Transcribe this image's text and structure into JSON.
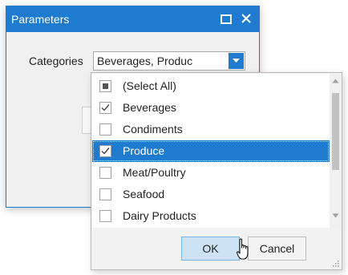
{
  "window": {
    "title": "Parameters",
    "maximize_icon": "maximize-icon",
    "close_icon": "close-icon"
  },
  "form": {
    "categories_label": "Categories",
    "categories_value": "Beverages, Produc"
  },
  "dropdown": {
    "items": [
      {
        "label": "(Select All)",
        "state": "indeterminate"
      },
      {
        "label": "Beverages",
        "state": "checked"
      },
      {
        "label": "Condiments",
        "state": "unchecked"
      },
      {
        "label": "Produce",
        "state": "checked",
        "highlighted": true
      },
      {
        "label": "Meat/Poultry",
        "state": "unchecked"
      },
      {
        "label": "Seafood",
        "state": "unchecked"
      },
      {
        "label": "Dairy Products",
        "state": "unchecked"
      }
    ],
    "ok_label": "OK",
    "cancel_label": "Cancel"
  },
  "colors": {
    "accent": "#1e7bd0",
    "ok_button_bg": "#cde3f5",
    "dialog_bg": "#f0f0f0"
  }
}
